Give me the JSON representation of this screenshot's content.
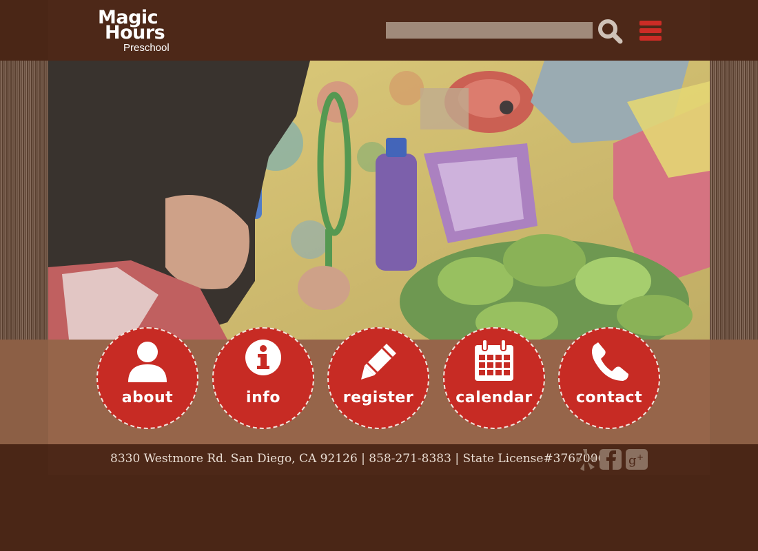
{
  "brand": {
    "line1": "Magic",
    "line2": "Hours",
    "line3": "Preschool"
  },
  "search": {
    "value": "",
    "placeholder": ""
  },
  "colors": {
    "accent": "#c72b24",
    "header_bg": "#4d2818",
    "band_bg": "#96654a"
  },
  "hero": {
    "description": "child-with-magnifying-glass-photo"
  },
  "nav": [
    {
      "label": "about",
      "icon": "user-icon"
    },
    {
      "label": "info",
      "icon": "info-icon"
    },
    {
      "label": "register",
      "icon": "pencil-icon"
    },
    {
      "label": "calendar",
      "icon": "calendar-icon"
    },
    {
      "label": "contact",
      "icon": "phone-icon"
    }
  ],
  "footer": {
    "text": "8330 Westmore Rd. San Diego, CA 92126 | 858-271-8383 |  State License#376700608",
    "social": [
      "yelp-icon",
      "facebook-icon",
      "google-plus-icon"
    ]
  }
}
